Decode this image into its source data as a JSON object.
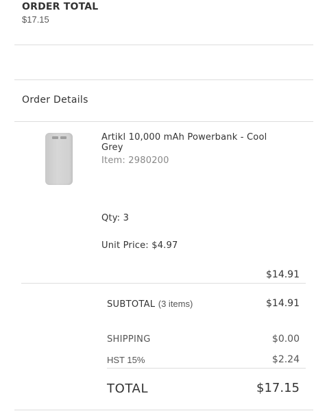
{
  "order_total": {
    "heading": "ORDER TOTAL",
    "value": "$17.15"
  },
  "order_details": {
    "heading": "Order Details"
  },
  "item": {
    "name": "Artikl 10,000 mAh Powerbank - Cool Grey",
    "item_number": "Item: 2980200",
    "qty_label": "Qty:",
    "qty_value": "3",
    "unit_price_label": "Unit Price:",
    "unit_price_value": "$4.97",
    "line_total": "$14.91",
    "image_icon": "powerbank-image"
  },
  "summary": {
    "subtotal_label": "SUBTOTAL",
    "subtotal_count": "(3 items)",
    "subtotal_value": "$14.91",
    "shipping_label": "SHIPPING",
    "shipping_value": "$0.00",
    "hst_label": "HST 15%",
    "hst_value": "$2.24",
    "total_label": "TOTAL",
    "total_value": "$17.15"
  },
  "colors": {
    "text": "#333333",
    "muted": "#888888",
    "divider": "#dddddd"
  }
}
